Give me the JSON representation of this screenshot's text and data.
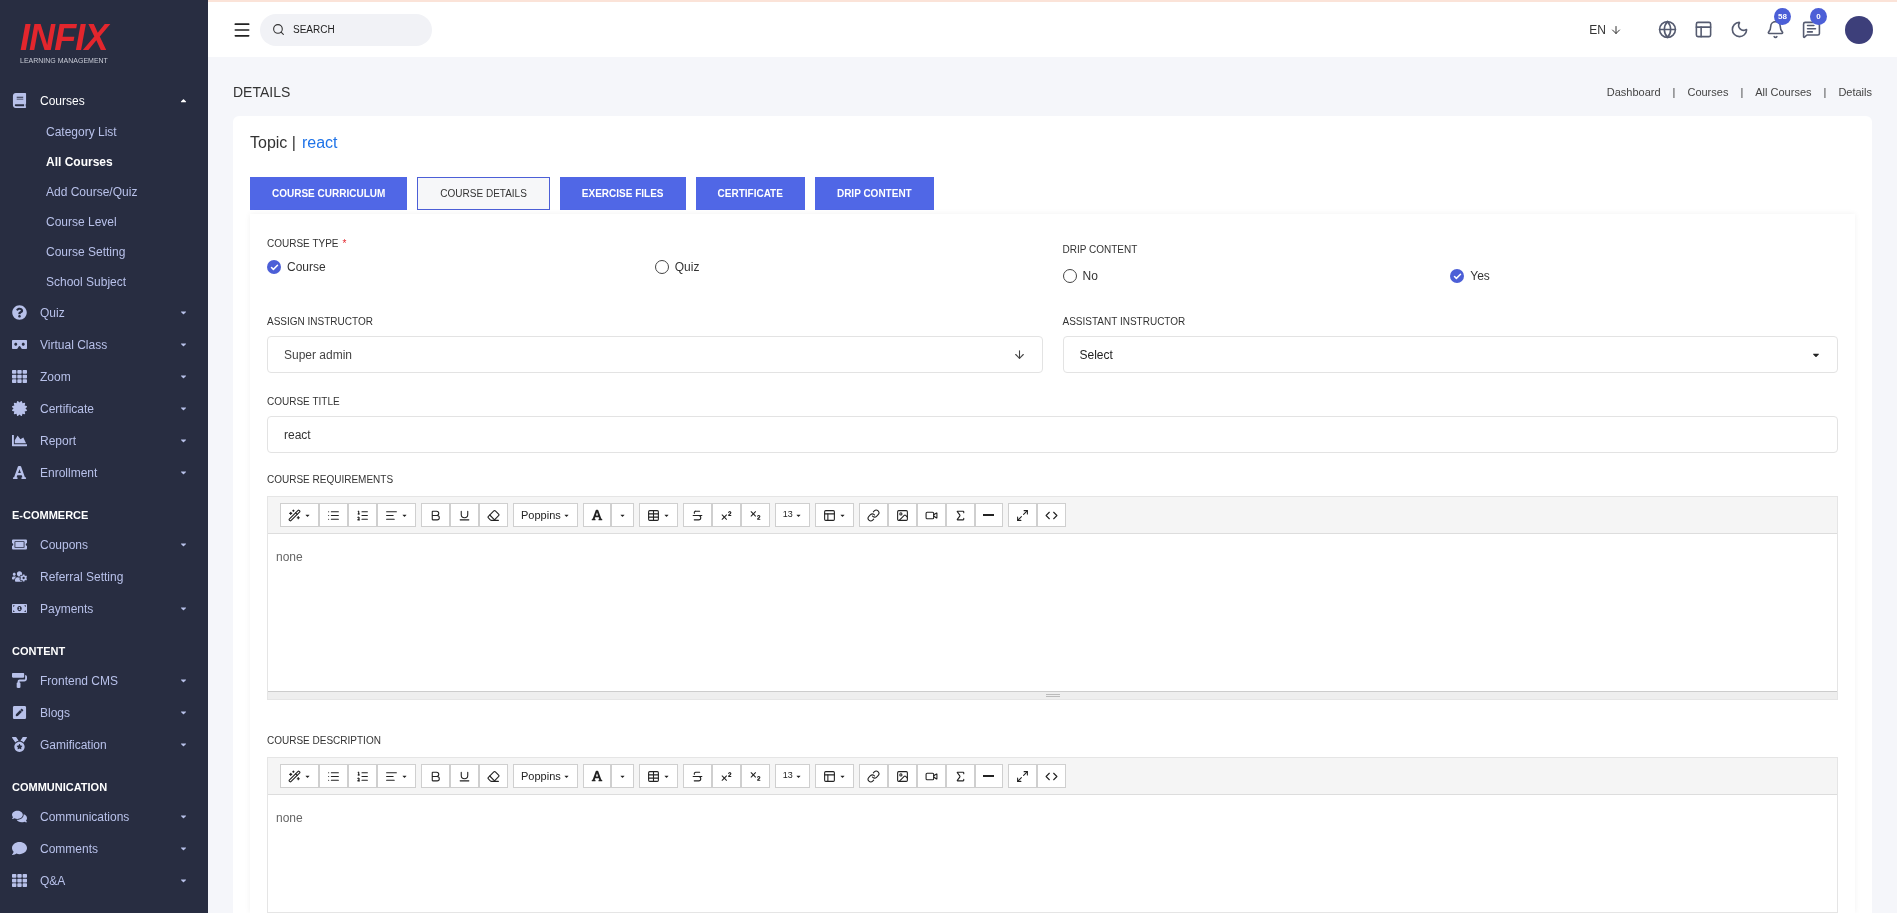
{
  "logo": {
    "name": "INFIX",
    "tagline": "LEARNING MANAGEMENT"
  },
  "sidebar": {
    "groups": [
      {
        "items": [
          {
            "label": "Courses",
            "kind": "menu",
            "expanded": true,
            "children": [
              {
                "label": "Category List",
                "selected": false
              },
              {
                "label": "All Courses",
                "selected": true
              },
              {
                "label": "Add Course/Quiz",
                "selected": false
              },
              {
                "label": "Course Level",
                "selected": false
              },
              {
                "label": "Course Setting",
                "selected": false
              },
              {
                "label": "School Subject",
                "selected": false
              }
            ]
          },
          {
            "label": "Quiz",
            "kind": "menu",
            "expanded": false
          },
          {
            "label": "Virtual Class",
            "kind": "menu",
            "expanded": false
          },
          {
            "label": "Zoom",
            "kind": "menu",
            "expanded": false
          },
          {
            "label": "Certificate",
            "kind": "menu",
            "expanded": false
          },
          {
            "label": "Report",
            "kind": "menu",
            "expanded": false
          },
          {
            "label": "Enrollment",
            "kind": "menu",
            "expanded": false
          }
        ]
      },
      {
        "heading": "E-COMMERCE",
        "items": [
          {
            "label": "Coupons",
            "kind": "menu",
            "expanded": false
          },
          {
            "label": "Referral Setting",
            "kind": "link"
          },
          {
            "label": "Payments",
            "kind": "menu",
            "expanded": false
          }
        ]
      },
      {
        "heading": "CONTENT",
        "items": [
          {
            "label": "Frontend CMS",
            "kind": "menu",
            "expanded": false
          },
          {
            "label": "Blogs",
            "kind": "menu",
            "expanded": false
          },
          {
            "label": "Gamification",
            "kind": "menu",
            "expanded": false
          }
        ]
      },
      {
        "heading": "COMMUNICATION",
        "items": [
          {
            "label": "Communications",
            "kind": "menu",
            "expanded": false
          },
          {
            "label": "Comments",
            "kind": "menu",
            "expanded": false
          },
          {
            "label": "Q&A",
            "kind": "menu",
            "expanded": false
          }
        ]
      }
    ]
  },
  "topbar": {
    "search": {
      "placeholder": "SEARCH"
    },
    "language": "EN",
    "notifications": "58",
    "messages": "0"
  },
  "page": {
    "title": "DETAILS",
    "breadcrumb": [
      "Dashboard",
      "Courses",
      "All Courses",
      "Details"
    ],
    "separator": "|"
  },
  "topic": {
    "label": "Topic |",
    "value": "react"
  },
  "tabs": [
    {
      "label": "COURSE CURRICULUM",
      "selected": false
    },
    {
      "label": "COURSE DETAILS",
      "selected": true
    },
    {
      "label": "EXERCISE FILES",
      "selected": false
    },
    {
      "label": "CERTIFICATE",
      "selected": false
    },
    {
      "label": "DRIP CONTENT",
      "selected": false
    }
  ],
  "form": {
    "course_type": {
      "label": "COURSE TYPE",
      "required": "*",
      "options": [
        {
          "label": "Course",
          "selected": true
        },
        {
          "label": "Quiz",
          "selected": false
        }
      ]
    },
    "drip_content": {
      "label": "DRIP CONTENT",
      "options": [
        {
          "label": "No",
          "selected": false
        },
        {
          "label": "Yes",
          "selected": true
        }
      ]
    },
    "assign_instructor": {
      "label": "ASSIGN INSTRUCTOR",
      "value": "Super admin"
    },
    "assistant_instructor": {
      "label": "ASSISTANT INSTRUCTOR",
      "value": "Select"
    },
    "course_title": {
      "label": "COURSE TITLE",
      "value": "react"
    },
    "editors": [
      {
        "label": "COURSE REQUIREMENTS",
        "font": "Poppins",
        "size": "13",
        "content": "none"
      },
      {
        "label": "COURSE DESCRIPTION",
        "font": "Poppins",
        "size": "13",
        "content": "none"
      }
    ]
  }
}
